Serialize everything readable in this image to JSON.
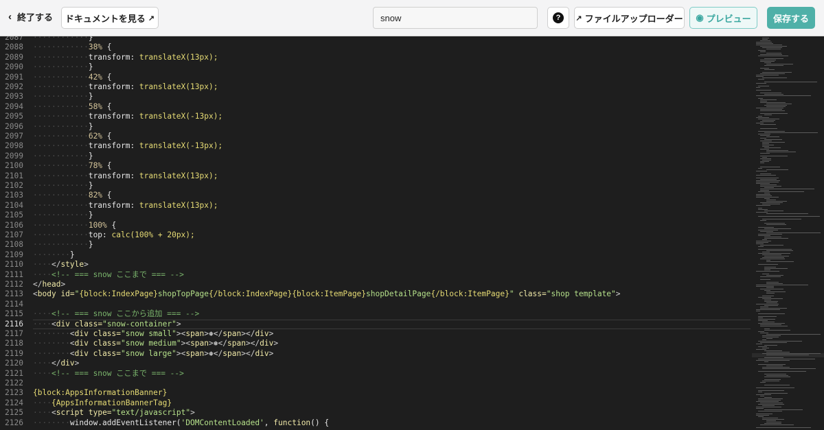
{
  "toolbar": {
    "exit_label": "終了する",
    "docs_label": "ドキュメントを見る",
    "search_value": "snow",
    "help_label": "?",
    "uploader_label": "ファイルアップローダー",
    "preview_label": "プレビュー",
    "save_label": "保存する"
  },
  "colors": {
    "accent": "#4fb0a8",
    "editor_bg": "#1e1e1e"
  },
  "editor": {
    "active_line": "2116",
    "lines": [
      {
        "n": "2087",
        "indent": 6,
        "tokens": [
          [
            "}",
            "t-punc"
          ]
        ]
      },
      {
        "n": "2088",
        "indent": 6,
        "tokens": [
          [
            "38%",
            "t-num"
          ],
          [
            " {",
            "t-punc"
          ]
        ]
      },
      {
        "n": "2089",
        "indent": 6,
        "tokens": [
          [
            "transform:",
            "t-prop"
          ],
          [
            " translateX(13px);",
            "t-val"
          ]
        ]
      },
      {
        "n": "2090",
        "indent": 6,
        "tokens": [
          [
            "}",
            "t-punc"
          ]
        ]
      },
      {
        "n": "2091",
        "indent": 6,
        "tokens": [
          [
            "42%",
            "t-num"
          ],
          [
            " {",
            "t-punc"
          ]
        ]
      },
      {
        "n": "2092",
        "indent": 6,
        "tokens": [
          [
            "transform:",
            "t-prop"
          ],
          [
            " translateX(13px);",
            "t-val"
          ]
        ]
      },
      {
        "n": "2093",
        "indent": 6,
        "tokens": [
          [
            "}",
            "t-punc"
          ]
        ]
      },
      {
        "n": "2094",
        "indent": 6,
        "tokens": [
          [
            "58%",
            "t-num"
          ],
          [
            " {",
            "t-punc"
          ]
        ]
      },
      {
        "n": "2095",
        "indent": 6,
        "tokens": [
          [
            "transform:",
            "t-prop"
          ],
          [
            " translateX(-13px);",
            "t-val"
          ]
        ]
      },
      {
        "n": "2096",
        "indent": 6,
        "tokens": [
          [
            "}",
            "t-punc"
          ]
        ]
      },
      {
        "n": "2097",
        "indent": 6,
        "tokens": [
          [
            "62%",
            "t-num"
          ],
          [
            " {",
            "t-punc"
          ]
        ]
      },
      {
        "n": "2098",
        "indent": 6,
        "tokens": [
          [
            "transform:",
            "t-prop"
          ],
          [
            " translateX(-13px);",
            "t-val"
          ]
        ]
      },
      {
        "n": "2099",
        "indent": 6,
        "tokens": [
          [
            "}",
            "t-punc"
          ]
        ]
      },
      {
        "n": "2100",
        "indent": 6,
        "tokens": [
          [
            "78%",
            "t-num"
          ],
          [
            " {",
            "t-punc"
          ]
        ]
      },
      {
        "n": "2101",
        "indent": 6,
        "tokens": [
          [
            "transform:",
            "t-prop"
          ],
          [
            " translateX(13px);",
            "t-val"
          ]
        ]
      },
      {
        "n": "2102",
        "indent": 6,
        "tokens": [
          [
            "}",
            "t-punc"
          ]
        ]
      },
      {
        "n": "2103",
        "indent": 6,
        "tokens": [
          [
            "82%",
            "t-num"
          ],
          [
            " {",
            "t-punc"
          ]
        ]
      },
      {
        "n": "2104",
        "indent": 6,
        "tokens": [
          [
            "transform:",
            "t-prop"
          ],
          [
            " translateX(13px);",
            "t-val"
          ]
        ]
      },
      {
        "n": "2105",
        "indent": 6,
        "tokens": [
          [
            "}",
            "t-punc"
          ]
        ]
      },
      {
        "n": "2106",
        "indent": 6,
        "tokens": [
          [
            "100%",
            "t-num"
          ],
          [
            " {",
            "t-punc"
          ]
        ]
      },
      {
        "n": "2107",
        "indent": 6,
        "tokens": [
          [
            "top:",
            "t-prop"
          ],
          [
            " calc(100% + 20px);",
            "t-val"
          ]
        ]
      },
      {
        "n": "2108",
        "indent": 6,
        "tokens": [
          [
            "}",
            "t-punc"
          ]
        ]
      },
      {
        "n": "2109",
        "indent": 4,
        "tokens": [
          [
            "}",
            "t-punc"
          ]
        ]
      },
      {
        "n": "2110",
        "indent": 2,
        "tokens": [
          [
            "</",
            "t-tag"
          ],
          [
            "style",
            "t-tagname"
          ],
          [
            ">",
            "t-tag"
          ]
        ]
      },
      {
        "n": "2111",
        "indent": 2,
        "tokens": [
          [
            "<!-- === snow ここまで === -->",
            "t-comment"
          ]
        ]
      },
      {
        "n": "2112",
        "indent": 0,
        "tokens": [
          [
            "</",
            "t-tag"
          ],
          [
            "head",
            "t-tagname"
          ],
          [
            ">",
            "t-tag"
          ]
        ]
      },
      {
        "n": "2113",
        "indent": 0,
        "tokens": [
          [
            "<",
            "t-tag"
          ],
          [
            "body",
            "t-tagname"
          ],
          [
            " id=",
            "t-attr"
          ],
          [
            "\"",
            "t-str"
          ],
          [
            "{block:IndexPage}",
            "t-block"
          ],
          [
            "shopTopPage",
            "t-str"
          ],
          [
            "{/block:IndexPage}{block:ItemPage}",
            "t-block"
          ],
          [
            "shopDetailPage",
            "t-str"
          ],
          [
            "{/block:ItemPage}",
            "t-block"
          ],
          [
            "\"",
            "t-str"
          ],
          [
            " class=",
            "t-attr"
          ],
          [
            "\"shop template\"",
            "t-str"
          ],
          [
            ">",
            "t-tag"
          ]
        ]
      },
      {
        "n": "2114",
        "indent": 0,
        "tokens": []
      },
      {
        "n": "2115",
        "indent": 2,
        "tokens": [
          [
            "<!-- === snow ここから追加 === -->",
            "t-comment"
          ]
        ]
      },
      {
        "n": "2116",
        "indent": 2,
        "tokens": [
          [
            "<",
            "t-tag"
          ],
          [
            "div",
            "t-tagname"
          ],
          [
            " class=",
            "t-attr"
          ],
          [
            "\"snow-container\"",
            "t-str"
          ],
          [
            ">",
            "t-tag"
          ]
        ]
      },
      {
        "n": "2117",
        "indent": 4,
        "tokens": [
          [
            "<",
            "t-tag"
          ],
          [
            "div",
            "t-tagname"
          ],
          [
            " class=",
            "t-attr"
          ],
          [
            "\"snow small\"",
            "t-str"
          ],
          [
            "><",
            "t-tag"
          ],
          [
            "span",
            "t-tagname"
          ],
          [
            ">",
            "t-tag"
          ],
          [
            "❅",
            "t-plain"
          ],
          [
            "</",
            "t-tag"
          ],
          [
            "span",
            "t-tagname"
          ],
          [
            "></",
            "t-tag"
          ],
          [
            "div",
            "t-tagname"
          ],
          [
            ">",
            "t-tag"
          ]
        ]
      },
      {
        "n": "2118",
        "indent": 4,
        "tokens": [
          [
            "<",
            "t-tag"
          ],
          [
            "div",
            "t-tagname"
          ],
          [
            " class=",
            "t-attr"
          ],
          [
            "\"snow medium\"",
            "t-str"
          ],
          [
            "><",
            "t-tag"
          ],
          [
            "span",
            "t-tagname"
          ],
          [
            ">",
            "t-tag"
          ],
          [
            "❅",
            "t-plain"
          ],
          [
            "</",
            "t-tag"
          ],
          [
            "span",
            "t-tagname"
          ],
          [
            "></",
            "t-tag"
          ],
          [
            "div",
            "t-tagname"
          ],
          [
            ">",
            "t-tag"
          ]
        ]
      },
      {
        "n": "2119",
        "indent": 4,
        "tokens": [
          [
            "<",
            "t-tag"
          ],
          [
            "div",
            "t-tagname"
          ],
          [
            " class=",
            "t-attr"
          ],
          [
            "\"snow large\"",
            "t-str"
          ],
          [
            "><",
            "t-tag"
          ],
          [
            "span",
            "t-tagname"
          ],
          [
            ">",
            "t-tag"
          ],
          [
            "❅",
            "t-plain"
          ],
          [
            "</",
            "t-tag"
          ],
          [
            "span",
            "t-tagname"
          ],
          [
            "></",
            "t-tag"
          ],
          [
            "div",
            "t-tagname"
          ],
          [
            ">",
            "t-tag"
          ]
        ]
      },
      {
        "n": "2120",
        "indent": 2,
        "tokens": [
          [
            "</",
            "t-tag"
          ],
          [
            "div",
            "t-tagname"
          ],
          [
            ">",
            "t-tag"
          ]
        ]
      },
      {
        "n": "2121",
        "indent": 2,
        "tokens": [
          [
            "<!-- === snow ここまで === -->",
            "t-comment"
          ]
        ]
      },
      {
        "n": "2122",
        "indent": 0,
        "tokens": []
      },
      {
        "n": "2123",
        "indent": 0,
        "tokens": [
          [
            "{block:AppsInformationBanner}",
            "t-block"
          ]
        ]
      },
      {
        "n": "2124",
        "indent": 2,
        "tokens": [
          [
            "{AppsInformationBannerTag}",
            "t-block"
          ]
        ]
      },
      {
        "n": "2125",
        "indent": 2,
        "tokens": [
          [
            "<",
            "t-tag"
          ],
          [
            "script",
            "t-tagname"
          ],
          [
            " type=",
            "t-attr"
          ],
          [
            "\"text/javascript\"",
            "t-str"
          ],
          [
            ">",
            "t-tag"
          ]
        ]
      },
      {
        "n": "2126",
        "indent": 4,
        "tokens": [
          [
            "window.addEventListener(",
            "t-plain"
          ],
          [
            "'DOMContentLoaded'",
            "t-str"
          ],
          [
            ", ",
            "t-plain"
          ],
          [
            "function",
            "t-tagname"
          ],
          [
            "() {",
            "t-plain"
          ]
        ]
      }
    ]
  }
}
